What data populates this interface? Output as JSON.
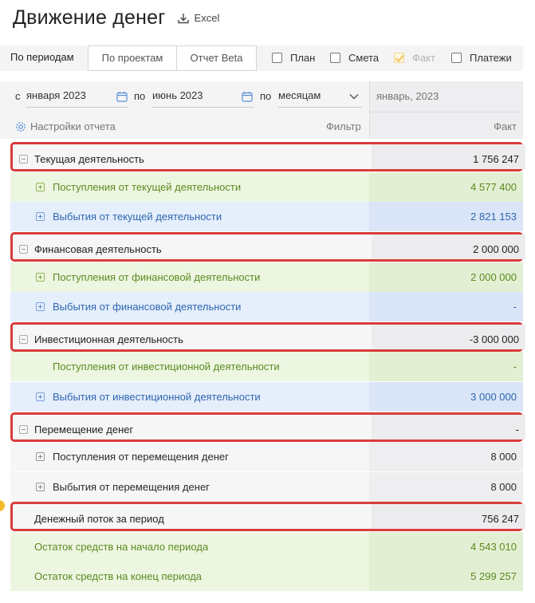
{
  "page": {
    "title": "Движение денег",
    "excel_label": "Excel"
  },
  "tabs": {
    "periods": "По периодам",
    "projects": "По проектам",
    "report_beta": "Отчет Beta"
  },
  "checks": {
    "plan": "План",
    "estimate": "Смета",
    "fact": "Факт",
    "payments": "Платежи"
  },
  "filters": {
    "from_label": "с",
    "from_value": "января 2023",
    "to_label": "по",
    "to_value": "июнь 2023",
    "by_label": "по",
    "by_value": "месяцам",
    "column_period": "январь, 2023",
    "settings_label": "Настройки отчета",
    "filter_label": "Фильтр",
    "fact_header": "Факт"
  },
  "rows": [
    {
      "label": "Текущая деятельность",
      "value": "1 756 247"
    },
    {
      "label": "Поступления от текущей деятельности",
      "value": "4 577 400"
    },
    {
      "label": "Выбытия от текущей деятельности",
      "value": "2 821 153"
    },
    {
      "label": "Финансовая деятельность",
      "value": "2 000 000"
    },
    {
      "label": "Поступления от финансовой деятельности",
      "value": "2 000 000"
    },
    {
      "label": "Выбытия от финансовой деятельности",
      "value": "-"
    },
    {
      "label": "Инвестиционная деятельность",
      "value": "-3 000 000"
    },
    {
      "label": "Поступления от инвестиционной деятельности",
      "value": "-"
    },
    {
      "label": "Выбытия от инвестиционной деятельности",
      "value": "3 000 000"
    },
    {
      "label": "Перемещение денег",
      "value": "-"
    },
    {
      "label": "Поступления от перемещения денег",
      "value": "8 000"
    },
    {
      "label": "Выбытия от перемещения денег",
      "value": "8 000"
    },
    {
      "label": "Денежный поток за период",
      "value": "756 247"
    },
    {
      "label": "Остаток средств на начало периода",
      "value": "4 543 010"
    },
    {
      "label": "Остаток средств на конец периода",
      "value": "5 299 257"
    }
  ]
}
